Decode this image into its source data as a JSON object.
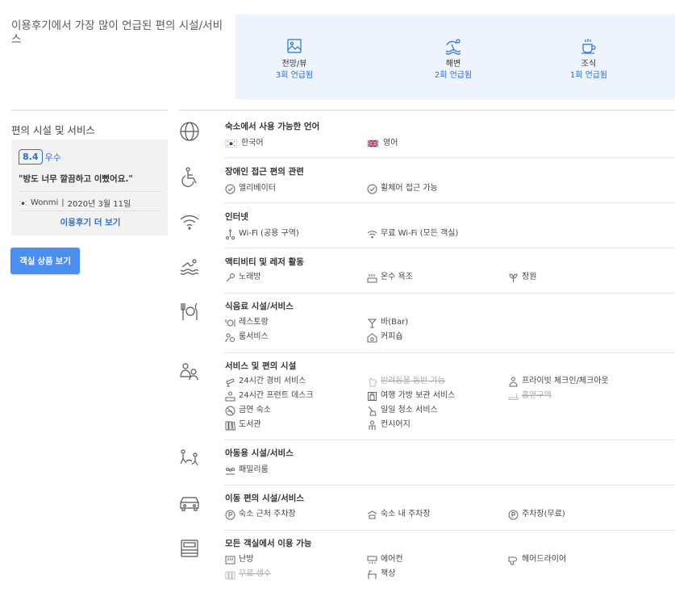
{
  "top": {
    "title": "이용후기에서 가장 많이 언급된 편의 시설/서비스",
    "highlights": [
      {
        "icon": "view-icon",
        "name": "전망/뷰",
        "count": "3회 언급됨"
      },
      {
        "icon": "beach-icon",
        "name": "해변",
        "count": "2회 언급됨"
      },
      {
        "icon": "breakfast-icon",
        "name": "조식",
        "count": "1회 언급됨"
      }
    ]
  },
  "sidebar": {
    "title": "편의 시설 및 서비스",
    "review": {
      "score": "8.4",
      "score_label": "우수",
      "quote": "\"방도 너무 깔끔하고 이뻤어요.\"",
      "reviewer": "Wonmi",
      "separator": "|",
      "date": "2020년 3월 11일",
      "more_link": "이용후기 더 보기"
    },
    "room_button": "객실 상품 보기"
  },
  "categories": {
    "language": {
      "title": "숙소에서 사용 가능한 언어",
      "items": [
        "한국어",
        "영어"
      ]
    },
    "accessibility": {
      "title": "장애인 접근 편의 관련",
      "items": [
        "엘리베이터",
        "휠체어 접근 가능"
      ]
    },
    "internet": {
      "title": "인터넷",
      "items": [
        "Wi-Fi (공용 구역)",
        "무료 Wi-Fi (모든 객실)"
      ]
    },
    "activities": {
      "title": "액티비티 및 레저 활동",
      "items": [
        "노래방",
        "온수 욕조",
        "정원"
      ]
    },
    "dining": {
      "title": "식음료 시설/서비스",
      "items": [
        "레스토랑",
        "바(Bar)",
        "룸서비스",
        "커피숍"
      ]
    },
    "services": {
      "title": "서비스 및 편의 시설",
      "items": [
        "24시간 경비 서비스",
        "반려동물 동반 가능",
        "프라이빗 체크인/체크아웃",
        "24시간 프런트 데스크",
        "여행 가방 보관 서비스",
        "흡연구역",
        "금연 숙소",
        "일일 청소 서비스",
        "도서관",
        "컨시어지"
      ]
    },
    "kids": {
      "title": "아동용 시설/서비스",
      "items": [
        "패밀리룸"
      ]
    },
    "transport": {
      "title": "이동 편의 시설/서비스",
      "items": [
        "숙소 근처 주차장",
        "숙소 내 주차장",
        "주차장(무료)"
      ]
    },
    "rooms": {
      "title": "모든 객실에서 이용 가능",
      "items": [
        "난방",
        "에어컨",
        "헤어드라이어",
        "무료 생수",
        "책상"
      ]
    }
  },
  "colors": {
    "accent": "#2b6fd6",
    "button": "#4a8ef0",
    "highlight_bg": "#eef4fd",
    "card_bg": "#f2f2f2"
  }
}
